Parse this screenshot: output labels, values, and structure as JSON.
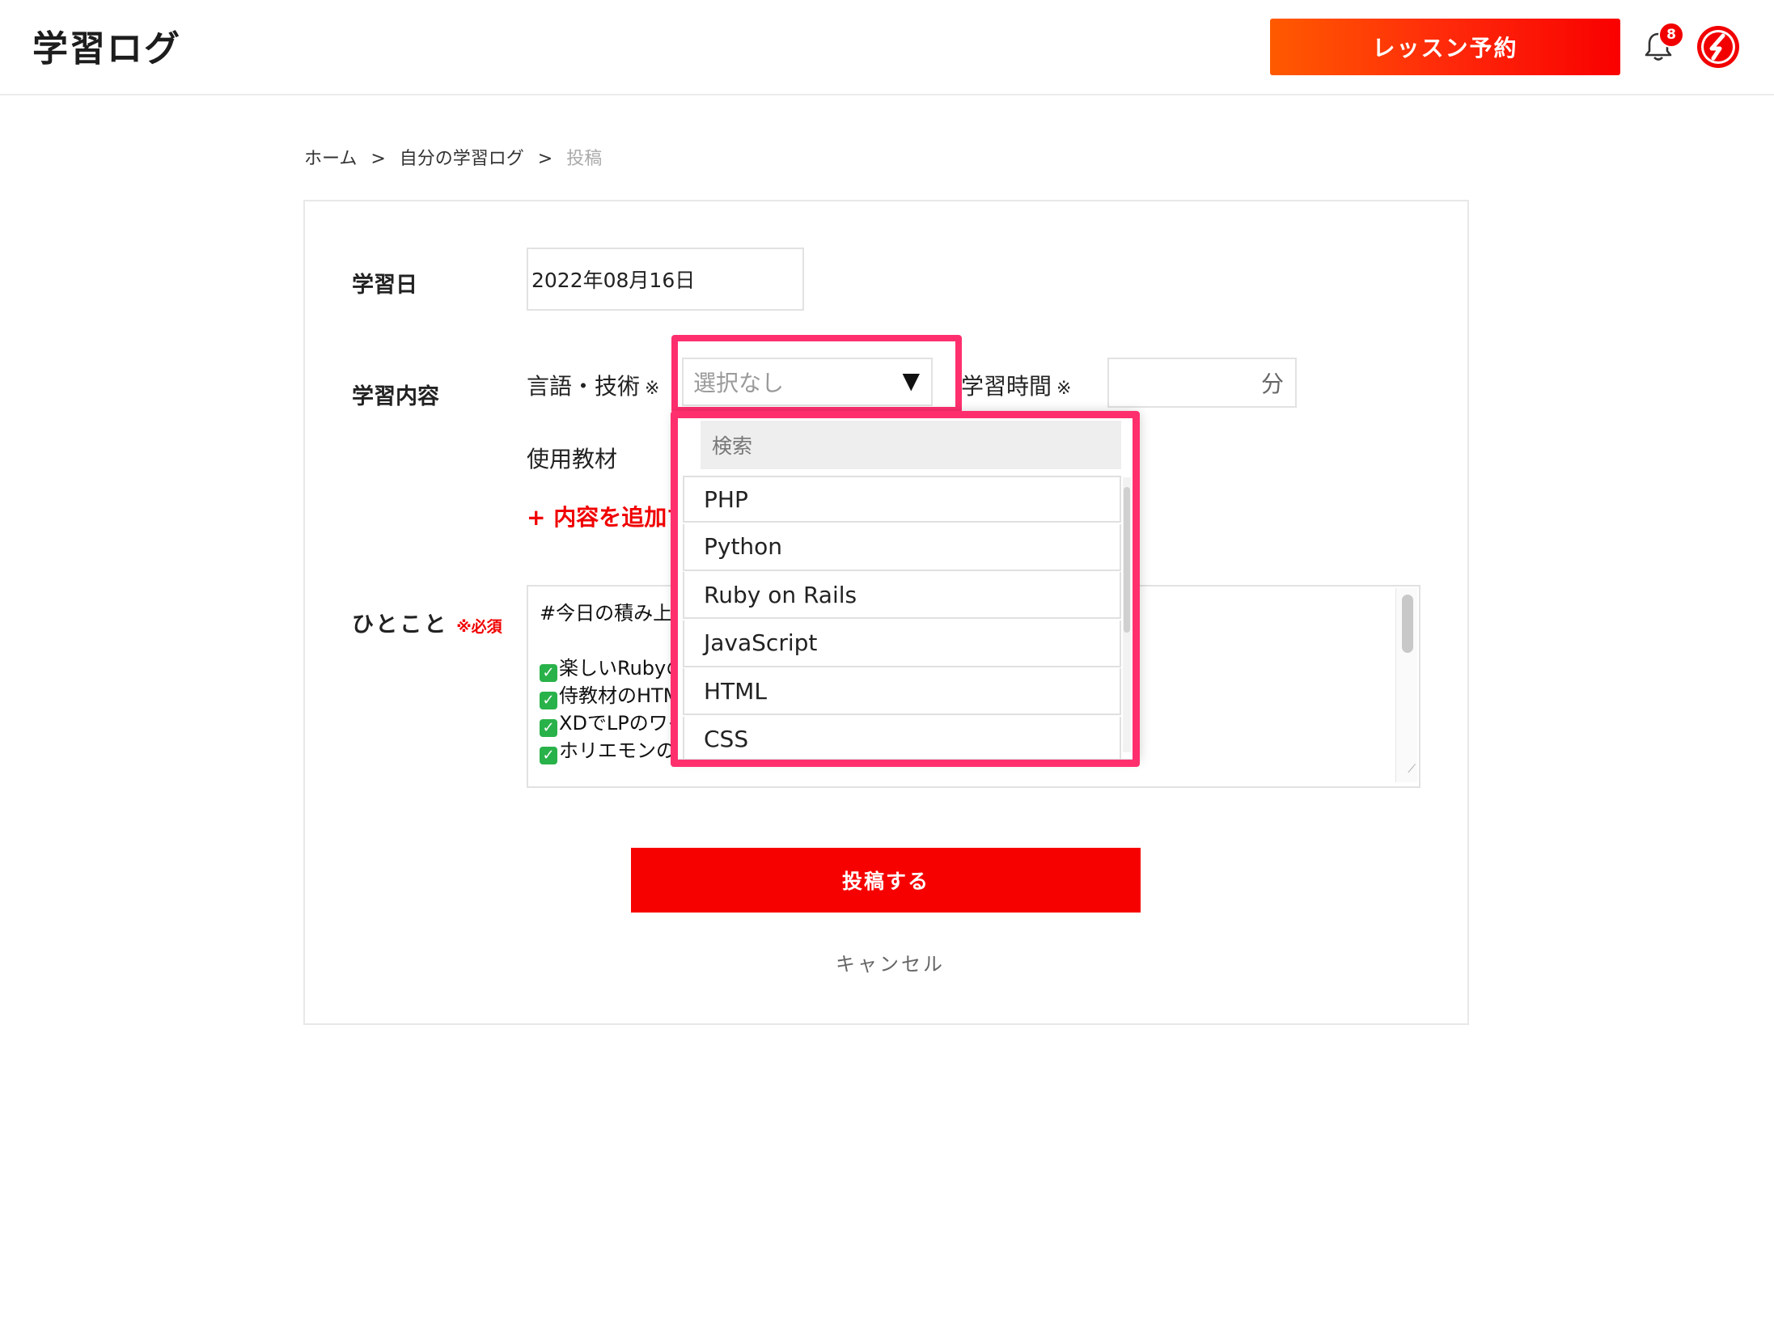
{
  "header": {
    "logo": "学習ログ",
    "reserve_label": "レッスン予約",
    "notification_count": "8"
  },
  "breadcrumb": {
    "home": "ホーム",
    "sep": ">",
    "mylog": "自分の学習ログ",
    "current": "投稿"
  },
  "form": {
    "date_label": "学習日",
    "date_value": "2022年08月16日",
    "content_label": "学習内容",
    "lang_label": "言語・技術",
    "required_mark": "※",
    "select_value": "選択なし",
    "select_caret": "▼",
    "time_label": "学習時間",
    "time_unit": "分",
    "material_label": "使用教材",
    "add_content": "+ 内容を追加する",
    "comment_label": "ひとこと",
    "comment_required": "※必須",
    "comment_lines": [
      "#今日の積み上げ",
      "",
      "楽しいRubyの",
      "侍教材のHTML",
      "XDでLPのワイヤー",
      "ホリエモンの「"
    ],
    "submit_label": "投稿する",
    "cancel_label": "キャンセル"
  },
  "dropdown": {
    "search_placeholder": "検索",
    "options": [
      "PHP",
      "Python",
      "Ruby on Rails",
      "JavaScript",
      "HTML",
      "CSS"
    ]
  },
  "colors": {
    "accent_red": "#f70000",
    "highlight_pink": "#ff2f6e",
    "reserve_gradient_start": "#ff5a00"
  }
}
